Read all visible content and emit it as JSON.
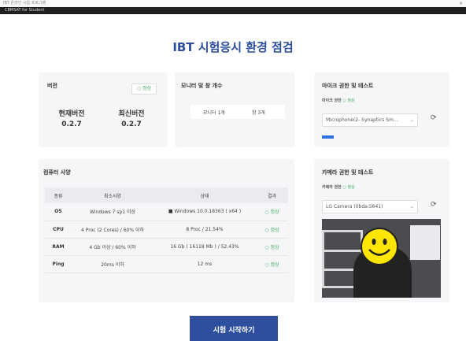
{
  "window": {
    "title": "IBT 온라인 시험 프로그램",
    "subtitle": "CBMSAT for Student",
    "close": "×"
  },
  "page_title": "IBT 시험응시 환경 점검",
  "version": {
    "title": "버전",
    "status": "정상",
    "current_label": "현재버전",
    "current_value": "0.2.7",
    "latest_label": "최신버전",
    "latest_value": "0.2.7"
  },
  "monitor": {
    "title": "모니터 및 창 개수",
    "monitors": "모니터 1개",
    "windows": "창 3개"
  },
  "mic": {
    "title": "마이크 권한 및 테스트",
    "perm_label": "마이크 권한",
    "perm_status": "정상",
    "device": "Microphone(2- Synaptics Sm...",
    "level": 0.1
  },
  "specs": {
    "title": "컴퓨터 사양",
    "headers": [
      "종류",
      "최소사양",
      "상태",
      "결과"
    ],
    "rows": [
      {
        "kind": "OS",
        "min": "Windows 7 sp1 이상",
        "state": "Windows 10.0.18363 ( x64 )",
        "result": "정상"
      },
      {
        "kind": "CPU",
        "min": "4 Proc (2 Cores) / 60% 이하",
        "state": "8 Proc / 21.54%",
        "result": "정상"
      },
      {
        "kind": "RAM",
        "min": "4 Gb 이상 / 60% 이하",
        "state": "16 Gb ( 16118 Mb ) / 52.43%",
        "result": "정상"
      },
      {
        "kind": "Ping",
        "min": "20ms 이하",
        "state": "12 ms",
        "result": "정상"
      }
    ]
  },
  "camera": {
    "title": "카메라 권한 및 테스트",
    "perm_label": "카메라 권한",
    "perm_status": "정상",
    "device": "LG Camera (0bda:5641)"
  },
  "start_button": "시험 시작하기",
  "icons": {
    "check": "check-circle-icon",
    "refresh": "refresh-icon",
    "chevron": "chevron-down-icon"
  },
  "colors": {
    "accent": "#2d4f9e",
    "ok": "#3daa5c"
  }
}
